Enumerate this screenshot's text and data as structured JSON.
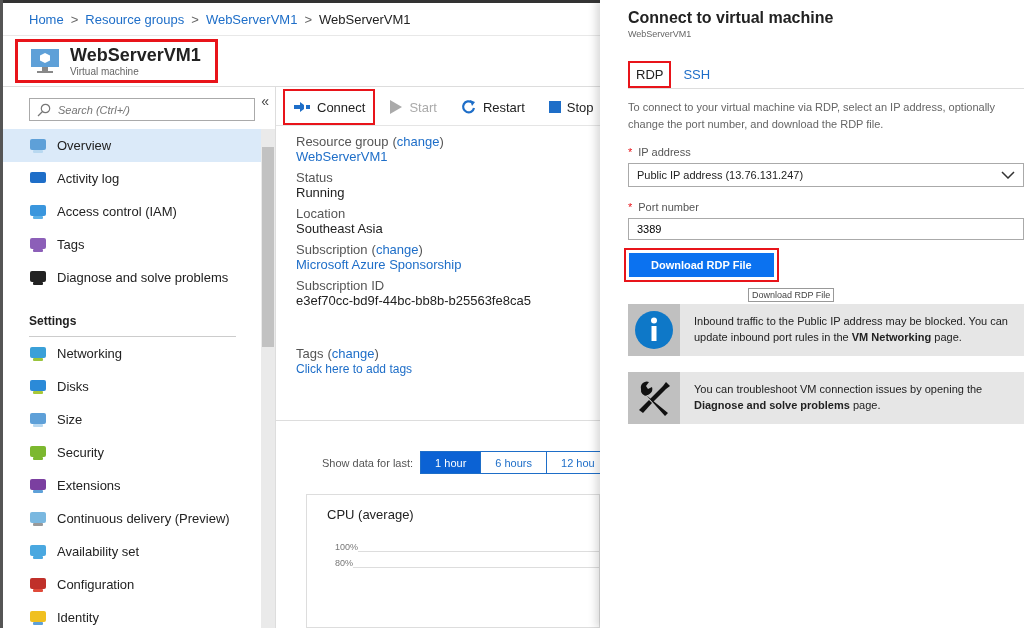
{
  "breadcrumb": [
    {
      "label": "Home",
      "link": true
    },
    {
      "label": "Resource groups",
      "link": true
    },
    {
      "label": "WebServerVM1",
      "link": true
    },
    {
      "label": "WebServerVM1",
      "link": false
    }
  ],
  "separator": ">",
  "paren_open": "(",
  "paren_close": ")",
  "required_marker": "*",
  "resource": {
    "name": "WebServerVM1",
    "type": "Virtual machine",
    "highlighted": true
  },
  "sidebar": {
    "search": {
      "placeholder": "Search (Ctrl+/)"
    },
    "collapse": "«",
    "sections": [
      {
        "items": [
          {
            "label": "Overview",
            "selected": true
          },
          {
            "label": "Activity log",
            "selected": false
          },
          {
            "label": "Access control (IAM)",
            "selected": false
          },
          {
            "label": "Tags",
            "selected": false
          },
          {
            "label": "Diagnose and solve problems",
            "selected": false
          }
        ]
      },
      {
        "heading": "Settings",
        "items": [
          {
            "label": "Networking",
            "selected": false
          },
          {
            "label": "Disks",
            "selected": false
          },
          {
            "label": "Size",
            "selected": false
          },
          {
            "label": "Security",
            "selected": false
          },
          {
            "label": "Extensions",
            "selected": false
          },
          {
            "label": "Continuous delivery (Preview)",
            "selected": false
          },
          {
            "label": "Availability set",
            "selected": false
          },
          {
            "label": "Configuration",
            "selected": false
          },
          {
            "label": "Identity",
            "selected": false
          }
        ]
      }
    ]
  },
  "toolbar": [
    {
      "kind": "connect",
      "label": "Connect",
      "disabled": false,
      "highlighted": true
    },
    {
      "kind": "start",
      "label": "Start",
      "disabled": true,
      "highlighted": false
    },
    {
      "kind": "restart",
      "label": "Restart",
      "disabled": false,
      "highlighted": false
    },
    {
      "kind": "stop",
      "label": "Stop",
      "disabled": false,
      "highlighted": false
    }
  ],
  "essentials": [
    {
      "label": "Resource group",
      "change": "change",
      "value": "WebServerVM1",
      "link": true
    },
    {
      "label": "Status",
      "value": "Running",
      "link": false
    },
    {
      "label": "Location",
      "value": "Southeast Asia",
      "link": false
    },
    {
      "label": "Subscription",
      "change": "change",
      "value": "Microsoft Azure Sponsorship",
      "link": true
    },
    {
      "label": "Subscription ID",
      "value": "e3ef70cc-bd9f-44bc-bb8b-b25563fe8ca5",
      "link": false
    }
  ],
  "tags": {
    "label": "Tags",
    "change": "change",
    "value": "Click here to add tags"
  },
  "time_range": {
    "label": "Show data for last:",
    "options": [
      {
        "label": "1 hour",
        "selected": true
      },
      {
        "label": "6 hours",
        "selected": false
      },
      {
        "label": "12 hou",
        "selected": false
      }
    ]
  },
  "cpu_chart": {
    "title": "CPU (average)",
    "y_tick_labels": [
      "100%",
      "80%"
    ]
  },
  "connect_panel": {
    "title": "Connect to virtual machine",
    "subtitle": "WebServerVM1",
    "tabs": [
      {
        "label": "RDP",
        "selected": true,
        "highlighted": true
      },
      {
        "label": "SSH",
        "selected": false,
        "highlighted": false
      }
    ],
    "description": "To connect to your virtual machine via RDP, select an IP address, optionally change the port number, and download the RDP file.",
    "ip_address": {
      "label": "IP address",
      "required": true,
      "value": "Public IP address (13.76.131.247)"
    },
    "port": {
      "label": "Port number",
      "required": true,
      "value": "3389"
    },
    "download": {
      "label": "Download RDP File",
      "highlighted": true,
      "tooltip": "Download RDP File"
    },
    "notices": [
      {
        "kind": "info",
        "text": "Inbound traffic to the Public IP address may be blocked. You can update inbound port rules in the **VM Networking** page."
      },
      {
        "kind": "tools",
        "text": "You can troubleshoot VM connection issues by opening the **Diagnose and solve problems** page."
      }
    ]
  }
}
